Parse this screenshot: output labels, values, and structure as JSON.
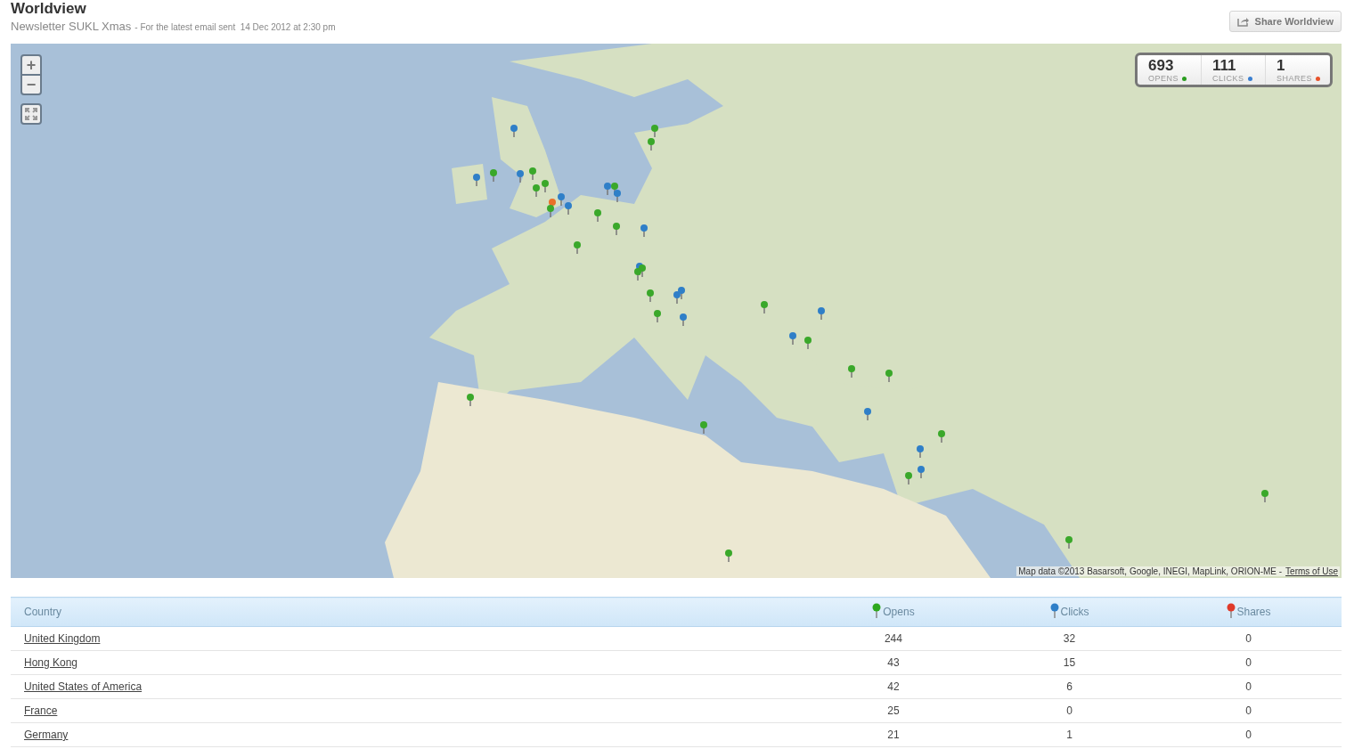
{
  "header": {
    "title": "Worldview",
    "newsletter": "Newsletter SUKL Xmas",
    "subtitle": "- For the latest email sent  14 Dec 2012 at 2:30 pm",
    "share_button": "Share Worldview"
  },
  "map": {
    "zoom_in": "+",
    "zoom_out": "−",
    "attribution": "Map data ©2013 Basarsoft, Google, INEGI, MapLink, ORION-ME -",
    "terms_link": "Terms of Use",
    "stats": [
      {
        "value": "693",
        "label": "OPENS",
        "color": "#2a9d1f"
      },
      {
        "value": "111",
        "label": "CLICKS",
        "color": "#3a7fd0"
      },
      {
        "value": "1",
        "label": "SHARES",
        "color": "#e8522a"
      }
    ]
  },
  "table": {
    "columns": [
      {
        "label": "Country"
      },
      {
        "label": "Opens",
        "color": "#2ea81e"
      },
      {
        "label": "Clicks",
        "color": "#2f7fc8"
      },
      {
        "label": "Shares",
        "color": "#e03a2a"
      }
    ],
    "rows": [
      {
        "country": "United Kingdom",
        "opens": "244",
        "clicks": "32",
        "shares": "0"
      },
      {
        "country": "Hong Kong",
        "opens": "43",
        "clicks": "15",
        "shares": "0"
      },
      {
        "country": "United States of America",
        "opens": "42",
        "clicks": "6",
        "shares": "0"
      },
      {
        "country": "France",
        "opens": "25",
        "clicks": "0",
        "shares": "0"
      },
      {
        "country": "Germany",
        "opens": "21",
        "clicks": "1",
        "shares": "0"
      }
    ]
  }
}
